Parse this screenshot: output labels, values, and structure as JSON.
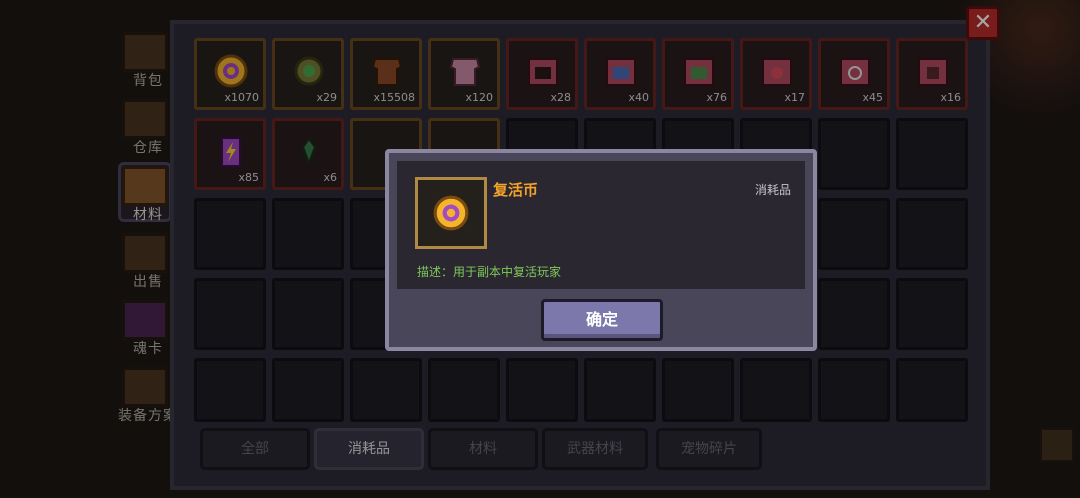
{
  "sidebar": {
    "items": [
      {
        "label": "背包",
        "active": false
      },
      {
        "label": "仓库",
        "active": false
      },
      {
        "label": "材料",
        "active": true
      },
      {
        "label": "出售",
        "active": false
      },
      {
        "label": "魂卡",
        "active": false
      },
      {
        "label": "装备方案",
        "active": false
      }
    ]
  },
  "inventory": {
    "items": [
      {
        "icon": "revive-coin-icon",
        "count": "x1070"
      },
      {
        "icon": "gear-part-icon",
        "count": "x29"
      },
      {
        "icon": "leather-hide-icon",
        "count": "x15508"
      },
      {
        "icon": "pink-hide-icon",
        "count": "x120"
      },
      {
        "icon": "chest-box-icon",
        "count": "x28"
      },
      {
        "icon": "armor-box-icon",
        "count": "x40"
      },
      {
        "icon": "scroll-box-icon",
        "count": "x76"
      },
      {
        "icon": "helmet-box-icon",
        "count": "x17"
      },
      {
        "icon": "ring-box-icon",
        "count": "x45"
      },
      {
        "icon": "pants-box-icon",
        "count": "x16"
      },
      {
        "icon": "battery-icon",
        "count": "x85"
      },
      {
        "icon": "plant-sprout-icon",
        "count": "x6"
      }
    ]
  },
  "tabs": [
    {
      "label": "全部",
      "active": false
    },
    {
      "label": "消耗品",
      "active": true
    },
    {
      "label": "材料",
      "active": false
    },
    {
      "label": "武器材料",
      "active": false
    },
    {
      "label": "宠物碎片",
      "active": false
    }
  ],
  "dialog": {
    "item_name": "复活币",
    "item_type": "消耗品",
    "description": "描述：用于副本中复活玩家",
    "confirm_label": "确定",
    "item_icon": "revive-coin-icon"
  },
  "close_button": {
    "label": "✕"
  },
  "colors": {
    "item_name": "#f4a32a",
    "description": "#7ec95b",
    "confirm_button": "#7d78ac",
    "close_button": "#b92b2b"
  }
}
